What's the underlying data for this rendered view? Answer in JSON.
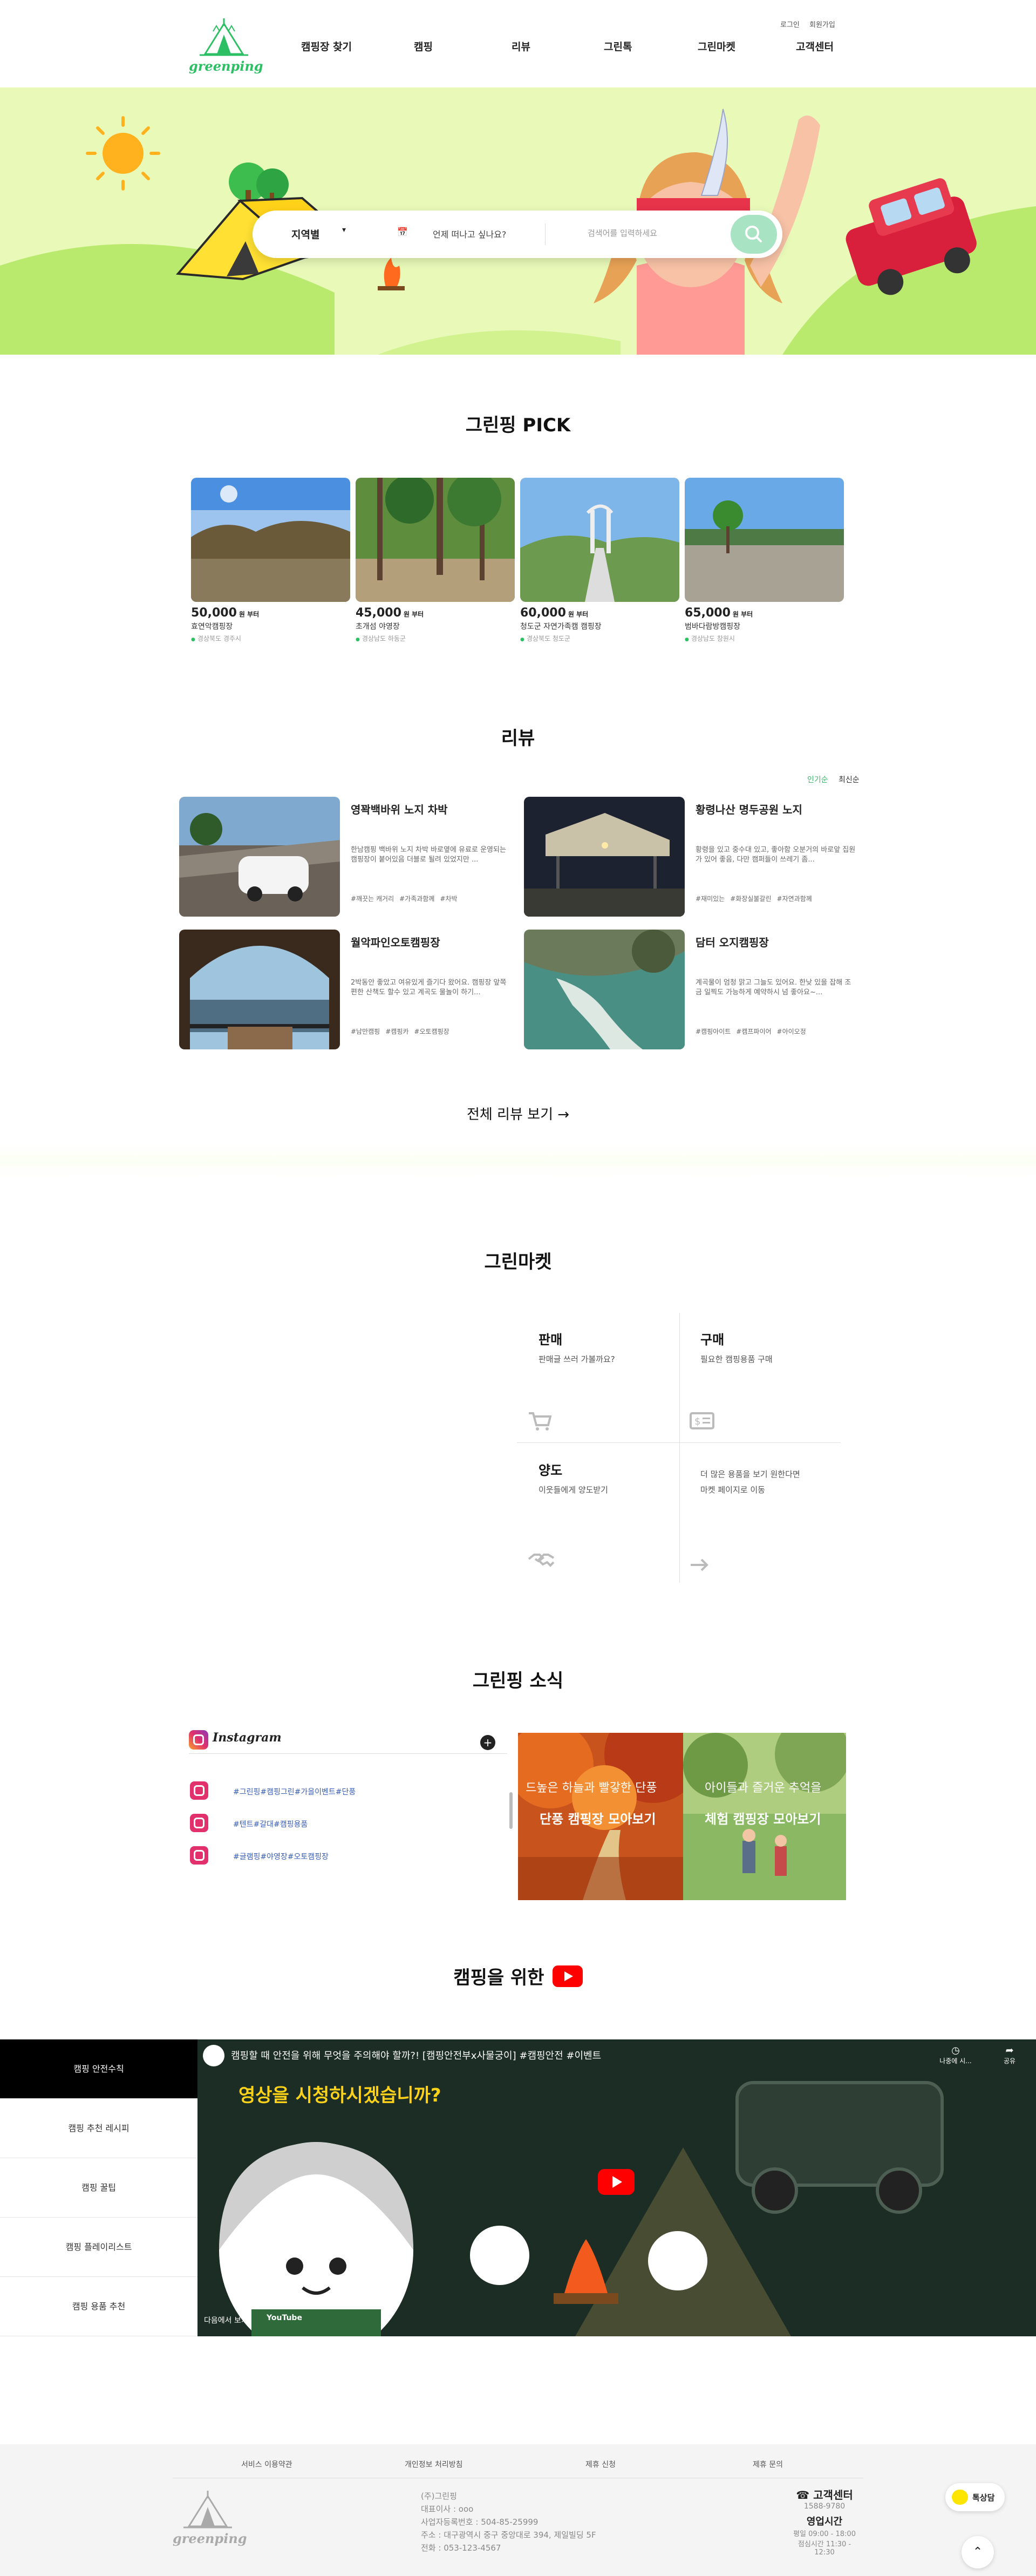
{
  "header": {
    "logo_text": "greenping",
    "util": [
      "로그인",
      "회원가입"
    ],
    "nav": [
      "캠핑장 찾기",
      "캠핑",
      "리뷰",
      "그린톡",
      "그린마켓",
      "고객센터"
    ]
  },
  "search": {
    "region_label": "지역별",
    "date_label": "언제 떠나고 싶나요?",
    "keyword_placeholder": "검색어를 입력하세요"
  },
  "pick": {
    "title": "그린핑 PICK",
    "per_label": "원 부터",
    "items": [
      {
        "price": "50,000",
        "name": "효연악캠핑장",
        "loc": "경상북도 경주시"
      },
      {
        "price": "45,000",
        "name": "초개섬 야영장",
        "loc": "경상남도 하동군"
      },
      {
        "price": "60,000",
        "name": "청도군 자연가족캠 캠핑장",
        "loc": "경상북도 청도군"
      },
      {
        "price": "65,000",
        "name": "범바다람방캠핑장",
        "loc": "경상남도 창원시"
      }
    ]
  },
  "review": {
    "title": "리뷰",
    "sort": [
      "인기순",
      "최신순"
    ],
    "items": [
      {
        "title": "영꽉백바위 노지 차박",
        "desc": "한남캠핑 백바위 노지 차박 바로옆에 유료로 운영되는 캠핑장이 붙어있음 더블로 될려 있었지만 ...",
        "tags": [
          "#깨끗는 캐거리",
          "#가족과함께",
          "#차박"
        ]
      },
      {
        "title": "황령나산 명두공원 노지",
        "desc": "황령을 있고 중수대 있고, 좋아함 오분거의 바로앞 집원가 있어 좋음, 다만 캠퍼들이 쓰레기 좀...",
        "tags": [
          "#재미있는",
          "#화장실불갈린",
          "#자연과함께"
        ]
      },
      {
        "title": "월악파인오토캠핑장",
        "desc": "2박동안 좋았고 여유있게 즐기다 왔어요. 캠핑장 앞쪽 편한 산책도 할수 있고 계곡도 물놀이 하기...",
        "tags": [
          "#남만캠핑",
          "#캠핑카",
          "#오토캠핑장"
        ]
      },
      {
        "title": "담터 오지캠핑장",
        "desc": "계곡물이 엄청 맑고 그늘도 있어요. 한낮 있을 잡해 조금 일찍도 가능하게 예약하시 넘 좋아요~...",
        "tags": [
          "#캠핑아이트",
          "#캠프파이어",
          "#아이오정"
        ]
      }
    ],
    "more": "전체 리뷰 보기 →"
  },
  "market": {
    "title": "그린마켓",
    "sell": {
      "title": "판매",
      "sub": "판매글 쓰러 가볼까요?"
    },
    "buy": {
      "title": "구매",
      "sub": "필요한 캠핑용품 구매"
    },
    "give": {
      "title": "양도",
      "sub": "이웃들에게 양도받기"
    },
    "more_l1": "더 많은 용품을 보기 원한다면",
    "more_l2": "마켓 페이지로 이동"
  },
  "news": {
    "title": "그린핑 소식",
    "insta_label": "Instagram",
    "tags": [
      "#그린핑#캠핑그린#가을이벤트#단풍",
      "#텐트#갈대#캠핑용품",
      "#글램핑#야영장#오토캠핑장"
    ],
    "banners": [
      {
        "caption": "드높은 하늘과 빨갛한 단풍",
        "title": "단풍 캠핑장 모아보기"
      },
      {
        "caption": "아이들과 즐거운 추억을",
        "title": "체험 캠핑장 모아보기"
      }
    ]
  },
  "video_section": {
    "title": "캠핑을 위한",
    "sidebar": [
      "캠핑 안전수칙",
      "캠핑 추천 레시피",
      "캠핑 꿀팁",
      "캠핑 플레이리스트",
      "캠핑 용품 추천"
    ],
    "video_title": "캠핑할 때 안전을 위해 무엇을 주의해야 할까?! [캠핑안전부x사물궁이] #캠핑안전 #이벤트",
    "video_overlay": "영상을 시청하시겠습니까?",
    "watch_later": "나중에 시...",
    "share": "공유",
    "watch_on": "다음에서 보기:",
    "yt": "YouTube"
  },
  "footer": {
    "links": [
      "서비스 이용약관",
      "개인정보 처리방침",
      "제휴 신청",
      "제휴 문의"
    ],
    "logo_text": "greenping",
    "info": [
      "(주)그린핑",
      "대표이사 : ooo",
      "사업자등록번호 : 504-85-25999",
      "주소 : 대구광역시 중구 중앙대로 394, 제일빌딩 5F",
      "전화 : 053-123-4567"
    ],
    "cs_title": "고객센터",
    "cs_phone": "1588-9780",
    "hours_title": "영업시간",
    "hours": [
      "평일 09:00 - 18:00",
      "점심시간 11:30 - 12:30"
    ],
    "chat": "톡상담"
  }
}
